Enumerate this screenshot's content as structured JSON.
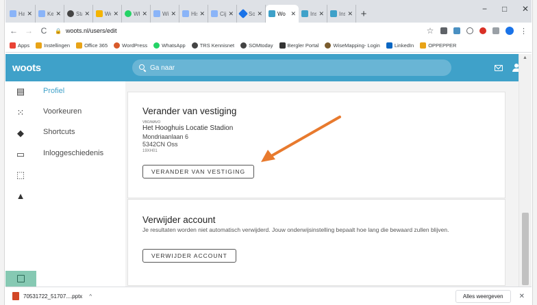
{
  "browser": {
    "tabs": [
      {
        "label": "Har",
        "color": "#8ab4f8"
      },
      {
        "label": "Keu",
        "color": "#8ab4f8"
      },
      {
        "label": "Stat",
        "color": "#444444"
      },
      {
        "label": "Wel",
        "color": "#f4b400"
      },
      {
        "label": "Wh",
        "color": "#25d366"
      },
      {
        "label": "Wil",
        "color": "#8ab4f8"
      },
      {
        "label": "Hist",
        "color": "#8ab4f8"
      },
      {
        "label": "Cijf",
        "color": "#8ab4f8"
      },
      {
        "label": "Son",
        "color": "#1a73e8"
      },
      {
        "label": "Wo",
        "color": "#3fa1c9",
        "active": true
      },
      {
        "label": "Inst",
        "color": "#3fa1c9"
      },
      {
        "label": "Inst",
        "color": "#3fa1c9"
      }
    ],
    "new_tab": "+",
    "minimize": "−",
    "maximize": "□",
    "close": "✕",
    "url": "woots.nl/users/edit",
    "bookmarks": [
      {
        "label": "Apps",
        "color": "#ea4335"
      },
      {
        "label": "Instellingen",
        "color": "#e8a317"
      },
      {
        "label": "Office 365",
        "color": "#e8a317"
      },
      {
        "label": "WordPress",
        "color": "#d85a2a"
      },
      {
        "label": "WhatsApp",
        "color": "#25d366"
      },
      {
        "label": "TRS Kennisnet",
        "color": "#444444"
      },
      {
        "label": "SOMtoday",
        "color": "#444444"
      },
      {
        "label": "Bergler Portal",
        "color": "#333333"
      },
      {
        "label": "WiseMapping- Login",
        "color": "#7a5c2e"
      },
      {
        "label": "LinkedIn",
        "color": "#0a66c2"
      },
      {
        "label": "OPPEPPER",
        "color": "#e8a317"
      }
    ]
  },
  "app": {
    "logo": "woots",
    "search_placeholder": "Ga naar"
  },
  "sidebar": {
    "items": [
      {
        "label": "Profiel",
        "active": true
      },
      {
        "label": "Voorkeuren"
      },
      {
        "label": "Shortcuts"
      },
      {
        "label": "Inloggeschiedenis"
      }
    ]
  },
  "change_location": {
    "title": "Verander van vestiging",
    "type": "VBO/MAVO",
    "school": "Het Hooghuis Locatie Stadion",
    "street": "Mondriaanlaan 6",
    "postal": "5342CN Oss",
    "code": "19XH01",
    "button": "VERANDER VAN VESTIGING"
  },
  "delete_account": {
    "title": "Verwijder account",
    "text": "Je resultaten worden niet automatisch verwijderd. Jouw onderwijsinstelling bepaalt hoe lang die bewaard zullen blijven.",
    "button": "VERWIJDER ACCOUNT"
  },
  "downloads": {
    "file": "70531722_51707....pptx",
    "show_all": "Alles weergeven",
    "close": "✕"
  },
  "colors": {
    "brand": "#3fa1c9",
    "arrow": "#e87a2e"
  }
}
